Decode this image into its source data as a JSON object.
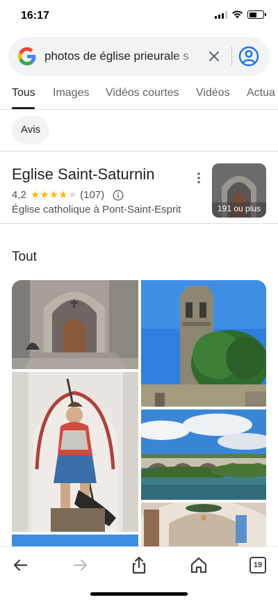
{
  "status_bar": {
    "time": "16:17",
    "battery_level": 0.55
  },
  "search": {
    "query": "photos de église prieurale s"
  },
  "tabs": [
    {
      "label": "Tous",
      "active": true
    },
    {
      "label": "Images",
      "active": false
    },
    {
      "label": "Vidéos courtes",
      "active": false
    },
    {
      "label": "Vidéos",
      "active": false
    },
    {
      "label": "Actua",
      "active": false
    }
  ],
  "chips": [
    {
      "label": "Avis"
    }
  ],
  "place": {
    "title": "Eglise Saint-Saturnin",
    "rating": "4,2",
    "rating_stars": 4.2,
    "review_count": "(107)",
    "subtitle": "Église catholique à Pont-Saint-Esprit",
    "photo_count": "191 ou plus"
  },
  "section": {
    "title": "Tout"
  },
  "images": [
    {
      "icon": "church-portal-photo"
    },
    {
      "icon": "bell-tower-photo"
    },
    {
      "icon": "saint-statue-photo"
    },
    {
      "icon": "river-bridge-photo"
    },
    {
      "icon": "church-interior-photo"
    },
    {
      "icon": "sky-photo"
    }
  ],
  "bottom_nav": {
    "tab_count": "19"
  },
  "colors": {
    "accent_blue": "#1a73e8",
    "star_yellow": "#fbbc04",
    "text_primary": "#202124",
    "text_secondary": "#5f6368"
  }
}
